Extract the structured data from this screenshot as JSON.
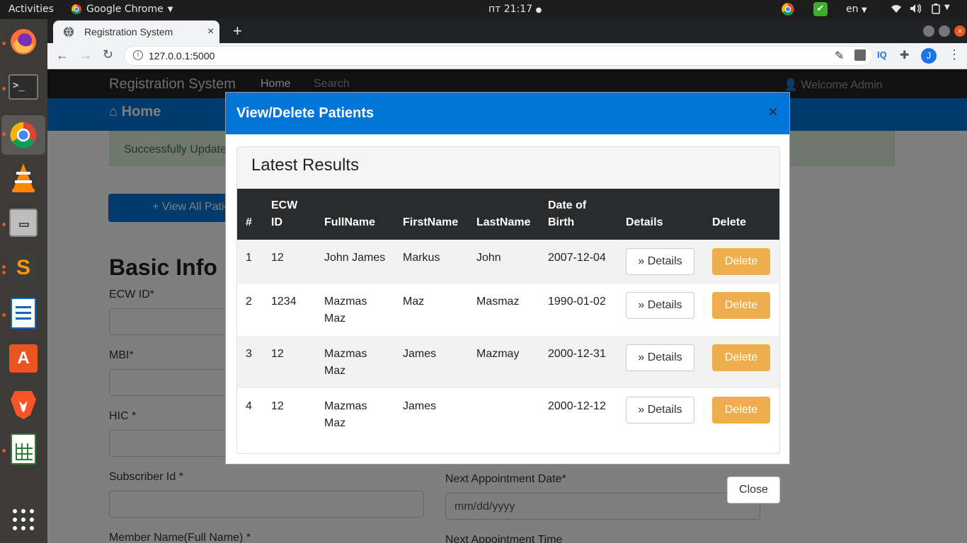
{
  "os": {
    "activities": "Activities",
    "app_menu": "Google Chrome",
    "clock": "пт 21:17",
    "language": "en"
  },
  "browser": {
    "tab_title": "Registration System",
    "url": "127.0.0.1:5000",
    "profile_initial": "J",
    "ext_iq": "IQ"
  },
  "site": {
    "brand": "Registration System",
    "nav_home": "Home",
    "nav_search": "Search",
    "welcome": "Welcome Admin",
    "jumbo_title": "Home",
    "alert": "Successfully Updated",
    "view_all_button": "View All Patients",
    "section_title": "Basic Info",
    "fields": {
      "ecw_id": "ECW ID*",
      "mbi": "MBI*",
      "hic": "HIC *",
      "subscriber_id": "Subscriber Id *",
      "member_name": "Member Name(Full Name) *",
      "next_appt_date": "Next Appointment Date*",
      "next_appt_date_placeholder": "mm/dd/yyyy",
      "next_appt_time": "Next Appointment Time"
    }
  },
  "modal": {
    "title": "View/Delete Patients",
    "close_x": "×",
    "card_title": "Latest Results",
    "columns": [
      "#",
      "ECW ID",
      "FullName",
      "FirstName",
      "LastName",
      "Date of Birth",
      "Details",
      "Delete"
    ],
    "rows": [
      {
        "n": "1",
        "ecw": "12",
        "full": "John James",
        "first": "Markus",
        "last": "John",
        "dob": "2007-12-04"
      },
      {
        "n": "2",
        "ecw": "1234",
        "full": "Mazmas Maz",
        "first": "Maz",
        "last": "Masmaz",
        "dob": "1990-01-02"
      },
      {
        "n": "3",
        "ecw": "12",
        "full": "Mazmas Maz",
        "first": "James",
        "last": "Mazmay",
        "dob": "2000-12-31"
      },
      {
        "n": "4",
        "ecw": "12",
        "full": "Mazmas Maz",
        "first": "James",
        "last": "",
        "dob": "2000-12-12"
      }
    ],
    "details_label": "Details",
    "delete_label": "Delete",
    "close_label": "Close"
  },
  "colors": {
    "primary": "#0275d8",
    "warning": "#f0ad4e",
    "navbar": "#222222",
    "table_head": "#292b2c"
  }
}
